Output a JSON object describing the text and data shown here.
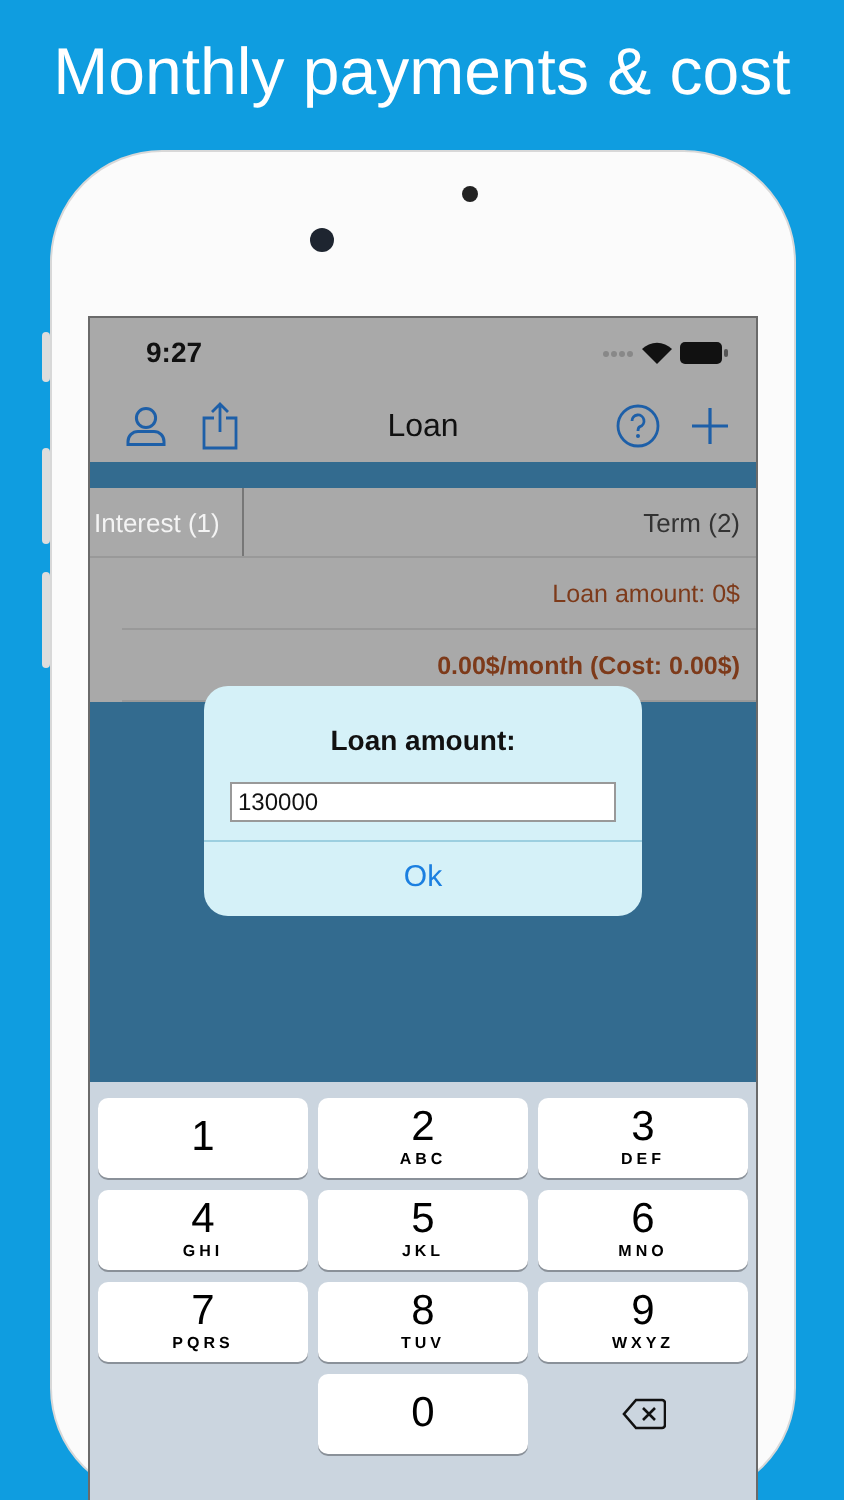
{
  "headline": "Monthly payments & cost",
  "status_bar": {
    "time": "9:27"
  },
  "nav_bar": {
    "title": "Loan"
  },
  "header_cells": [
    "Interest (1)",
    "Term (2)"
  ],
  "rows": [
    {
      "text": "Loan amount: 0$",
      "bold": false
    },
    {
      "text": "0.00$/month (Cost: 0.00$)",
      "bold": true
    }
  ],
  "dialog": {
    "title": "Loan amount:",
    "value": "130000",
    "button": "Ok"
  },
  "keypad": [
    {
      "kind": "key",
      "digit": "1"
    },
    {
      "kind": "key",
      "digit": "2",
      "letters": "ABC"
    },
    {
      "kind": "key",
      "digit": "3",
      "letters": "DEF"
    },
    {
      "kind": "key",
      "digit": "4",
      "letters": "GHI"
    },
    {
      "kind": "key",
      "digit": "5",
      "letters": "JKL"
    },
    {
      "kind": "key",
      "digit": "6",
      "letters": "MNO"
    },
    {
      "kind": "key",
      "digit": "7",
      "letters": "PQRS"
    },
    {
      "kind": "key",
      "digit": "8",
      "letters": "TUV"
    },
    {
      "kind": "key",
      "digit": "9",
      "letters": "WXYZ"
    },
    {
      "kind": "blank"
    },
    {
      "kind": "key",
      "digit": "0"
    },
    {
      "kind": "delete"
    }
  ]
}
